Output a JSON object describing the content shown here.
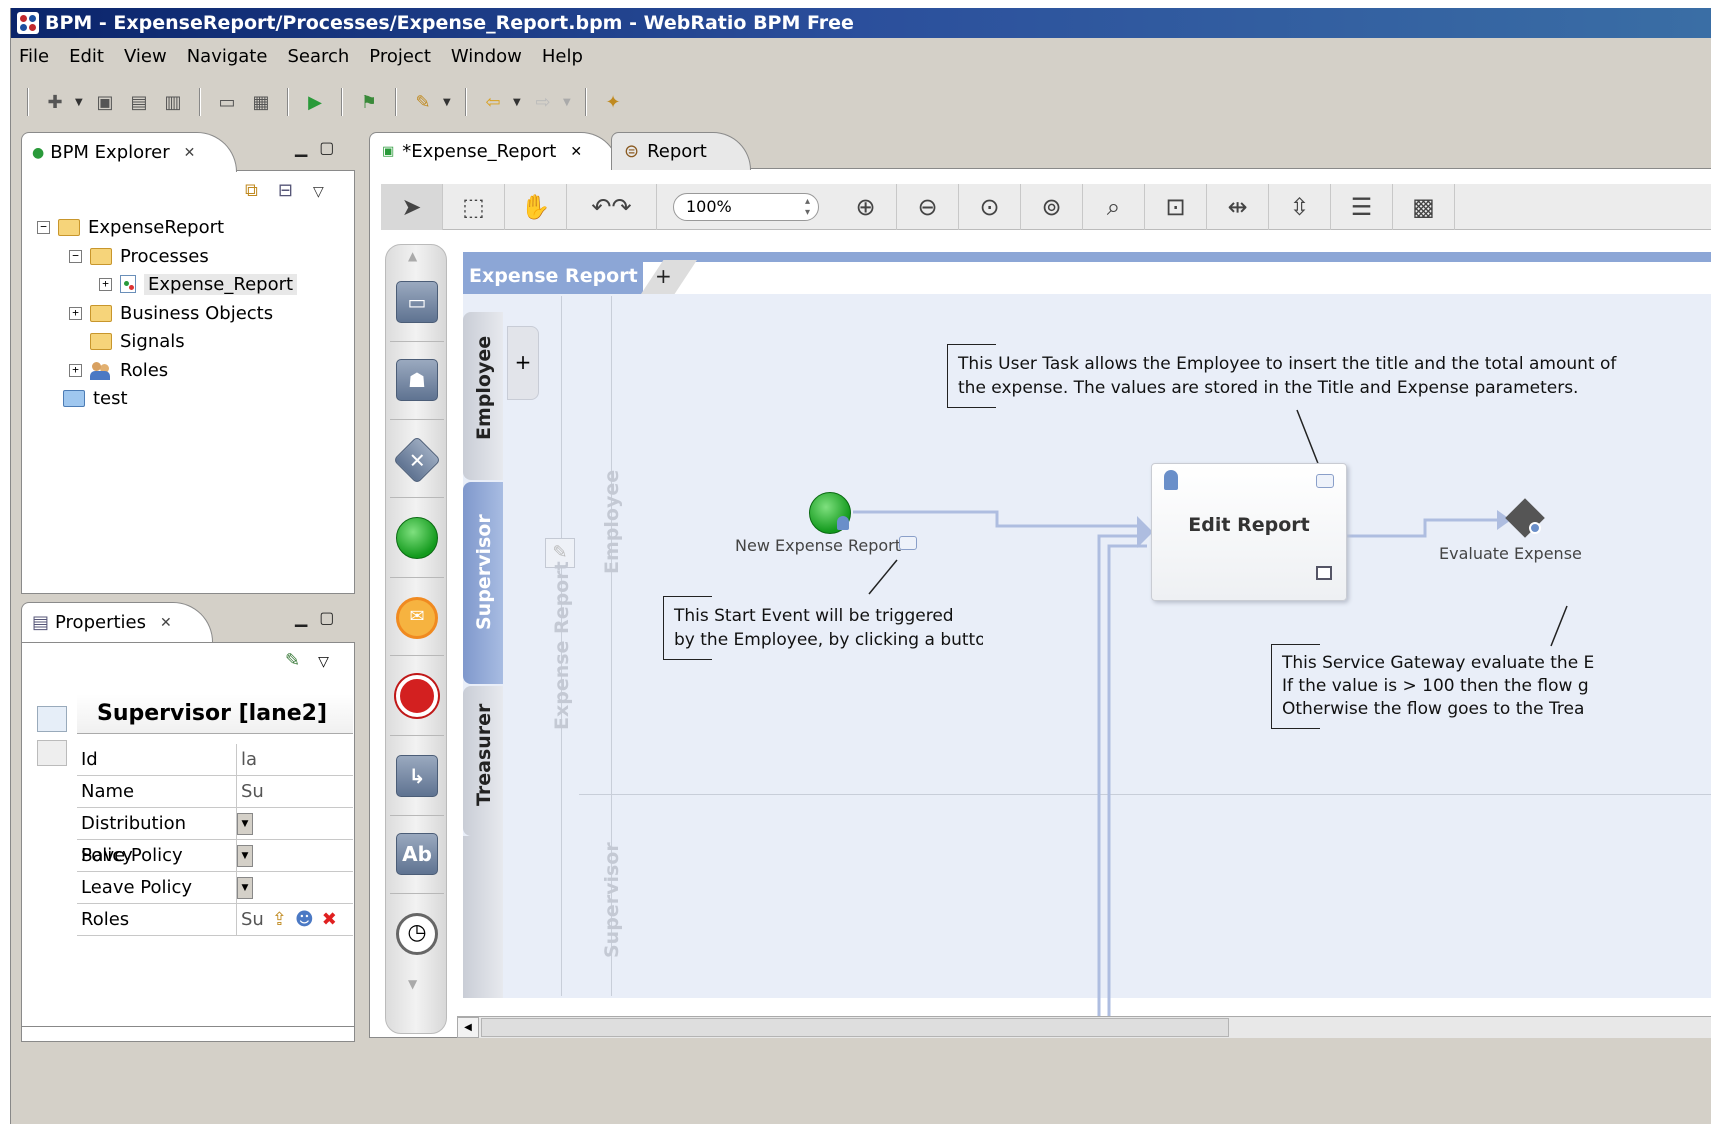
{
  "window": {
    "title": "BPM - ExpenseReport/Processes/Expense_Report.bpm - WebRatio BPM Free"
  },
  "menu": [
    "File",
    "Edit",
    "View",
    "Navigate",
    "Search",
    "Project",
    "Window",
    "Help"
  ],
  "explorer": {
    "tab_label": "BPM Explorer",
    "tree": {
      "root": "ExpenseReport",
      "processes": "Processes",
      "expense_report": "Expense_Report",
      "business_objects": "Business Objects",
      "signals": "Signals",
      "roles": "Roles",
      "test": "test"
    }
  },
  "properties": {
    "tab_label": "Properties",
    "title": "Supervisor [lane2]",
    "rows": [
      {
        "name": "Id",
        "value": "la"
      },
      {
        "name": "Name",
        "value": "Su"
      },
      {
        "name": "Distribution Policy",
        "value": ""
      },
      {
        "name": "Save Policy",
        "value": ""
      },
      {
        "name": "Leave Policy",
        "value": ""
      },
      {
        "name": "Roles",
        "value": "Su"
      }
    ]
  },
  "editor": {
    "tabs": [
      "*Expense_Report",
      "Report"
    ],
    "zoom": "100%",
    "pool_title": "Expense Report",
    "pool_plus": "+",
    "lanes": [
      "Employee",
      "Supervisor",
      "Treasurer"
    ],
    "lane_plus": "+",
    "palette_text_tool": "Ab",
    "ghost_labels": {
      "pool": "Expense Report",
      "employee": "Employee",
      "supervisor": "Supervisor"
    },
    "start_event_label": "New Expense Report",
    "task_label": "Edit Report",
    "gateway_label": "Evaluate Expense",
    "notes": {
      "user_task": [
        "This User Task allows the Employee to insert the title and the total amount of",
        "the expense. The values are stored in the Title and Expense parameters."
      ],
      "start_event": [
        "This Start Event will be triggered",
        "by the Employee, by clicking a button"
      ],
      "gateway": [
        "This Service Gateway evaluate the E",
        "If the value is > 100 then the flow g",
        "Otherwise the flow goes to the Trea"
      ]
    }
  },
  "colors": {
    "title_bar": "#0a246a",
    "pool": "#8ca6d6",
    "lane_bg": "#e9eef8",
    "start_event": "#139a1d",
    "end_event": "#d32020"
  }
}
